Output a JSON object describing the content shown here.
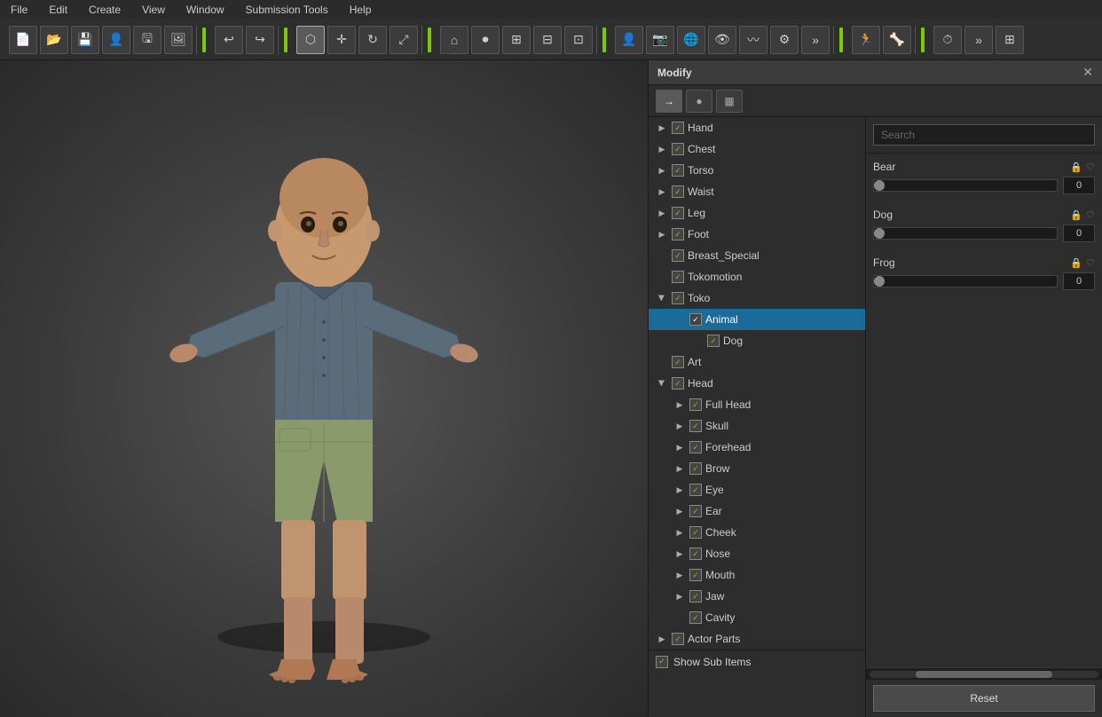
{
  "menu": {
    "items": [
      "File",
      "Edit",
      "Create",
      "View",
      "Window",
      "Submission Tools",
      "Help"
    ]
  },
  "toolbar": {
    "groups": [
      [
        "new",
        "open",
        "save",
        "figure",
        "save-scene",
        "render"
      ],
      [
        "undo",
        "redo"
      ],
      [
        "select",
        "transform",
        "rotate",
        "scale"
      ],
      [
        "frame",
        "record",
        "add-node",
        "node-opt",
        "layout"
      ],
      [
        "figure-tool",
        "camera",
        "perspective",
        "render-preview",
        "cloth",
        "settings",
        "more"
      ],
      [
        "pose",
        "bone"
      ],
      [
        "timeline",
        "more2",
        "frame-all"
      ]
    ]
  },
  "modify_panel": {
    "title": "Modify",
    "close_label": "✕",
    "tabs": [
      {
        "id": "tab-morph",
        "icon": "→",
        "active": true
      },
      {
        "id": "tab-material",
        "icon": "●"
      },
      {
        "id": "tab-grid",
        "icon": "▦"
      }
    ]
  },
  "tree": {
    "items": [
      {
        "id": "hand",
        "label": "Hand",
        "level": 1,
        "has_arrow": true,
        "checked": true,
        "expanded": false
      },
      {
        "id": "chest",
        "label": "Chest",
        "level": 1,
        "has_arrow": true,
        "checked": true,
        "expanded": false
      },
      {
        "id": "torso",
        "label": "Torso",
        "level": 1,
        "has_arrow": true,
        "checked": true,
        "expanded": false
      },
      {
        "id": "waist",
        "label": "Waist",
        "level": 1,
        "has_arrow": true,
        "checked": true,
        "expanded": false
      },
      {
        "id": "leg",
        "label": "Leg",
        "level": 1,
        "has_arrow": true,
        "checked": true,
        "expanded": false
      },
      {
        "id": "foot",
        "label": "Foot",
        "level": 1,
        "has_arrow": true,
        "checked": true,
        "expanded": false
      },
      {
        "id": "breast-special",
        "label": "Breast_Special",
        "level": 1,
        "has_arrow": false,
        "checked": true,
        "expanded": false
      },
      {
        "id": "tokomotion",
        "label": "Tokomotion",
        "level": 1,
        "has_arrow": false,
        "checked": true,
        "expanded": false
      },
      {
        "id": "toko",
        "label": "Toko",
        "level": 1,
        "has_arrow": true,
        "checked": true,
        "expanded": true
      },
      {
        "id": "animal",
        "label": "Animal",
        "level": 2,
        "has_arrow": false,
        "checked": true,
        "expanded": false,
        "selected": true
      },
      {
        "id": "dog-sub",
        "label": "Dog",
        "level": 3,
        "has_arrow": false,
        "checked": true,
        "expanded": false
      },
      {
        "id": "art",
        "label": "Art",
        "level": 1,
        "has_arrow": false,
        "checked": true,
        "expanded": false
      },
      {
        "id": "head",
        "label": "Head",
        "level": 1,
        "has_arrow": true,
        "checked": true,
        "expanded": true
      },
      {
        "id": "full-head",
        "label": "Full Head",
        "level": 2,
        "has_arrow": true,
        "checked": true,
        "expanded": false
      },
      {
        "id": "skull",
        "label": "Skull",
        "level": 2,
        "has_arrow": true,
        "checked": true,
        "expanded": false
      },
      {
        "id": "forehead",
        "label": "Forehead",
        "level": 2,
        "has_arrow": true,
        "checked": true,
        "expanded": false
      },
      {
        "id": "brow",
        "label": "Brow",
        "level": 2,
        "has_arrow": true,
        "checked": true,
        "expanded": false
      },
      {
        "id": "eye",
        "label": "Eye",
        "level": 2,
        "has_arrow": true,
        "checked": true,
        "expanded": false
      },
      {
        "id": "ear",
        "label": "Ear",
        "level": 2,
        "has_arrow": true,
        "checked": true,
        "expanded": false
      },
      {
        "id": "cheek",
        "label": "Cheek",
        "level": 2,
        "has_arrow": true,
        "checked": true,
        "expanded": false
      },
      {
        "id": "nose",
        "label": "Nose",
        "level": 2,
        "has_arrow": true,
        "checked": true,
        "expanded": false
      },
      {
        "id": "mouth",
        "label": "Mouth",
        "level": 2,
        "has_arrow": true,
        "checked": true,
        "expanded": false
      },
      {
        "id": "jaw",
        "label": "Jaw",
        "level": 2,
        "has_arrow": true,
        "checked": true,
        "expanded": false
      },
      {
        "id": "cavity",
        "label": "Cavity",
        "level": 2,
        "has_arrow": false,
        "checked": true,
        "expanded": false
      },
      {
        "id": "actor-parts",
        "label": "Actor Parts",
        "level": 1,
        "has_arrow": true,
        "checked": true,
        "expanded": false
      }
    ],
    "show_sub_items": "Show Sub Items"
  },
  "search": {
    "placeholder": "Search"
  },
  "morphs": [
    {
      "name": "Bear",
      "value": "0",
      "slider_pct": 0
    },
    {
      "name": "Dog",
      "value": "0",
      "slider_pct": 0
    },
    {
      "name": "Frog",
      "value": "0",
      "slider_pct": 0
    }
  ],
  "reset_button": "Reset",
  "icons": {
    "lock": "🔒",
    "heart": "♡",
    "check": "✓",
    "arrow_right": "▶",
    "arrow_down": "▼",
    "close": "✕"
  }
}
